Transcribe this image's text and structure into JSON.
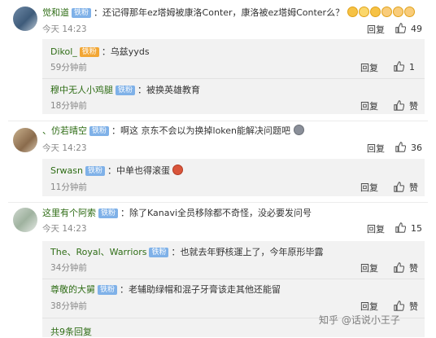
{
  "comments": [
    {
      "user": "觉和道",
      "badge": "铁粉",
      "text": "：还记得那年ez塔姆被康洛Conter，康洛被ez塔姆Conter么？",
      "time": "今天 14:23",
      "reply_label": "回复",
      "likes": "49",
      "emojis": [
        "laugh-emoji",
        "laugh-emoji",
        "laugh-emoji",
        "cat-emoji",
        "cat-emoji",
        "cat-emoji"
      ],
      "replies": [
        {
          "user": "Dikol_",
          "badge": "铁粉",
          "text": "：乌兹yyds",
          "time": "59分钟前",
          "reply_label": "回复",
          "likes": "1"
        },
        {
          "user": "穆中无人小鸡腿",
          "badge": "铁粉",
          "text": "：被换英雄教育",
          "time": "18分钟前",
          "reply_label": "回复",
          "likes": "赞"
        }
      ]
    },
    {
      "user": "、仿若晴空",
      "badge": "铁粉",
      "text": "：啊这 京东不会以为换掉loken能解决问题吧",
      "time": "今天 14:23",
      "reply_label": "回复",
      "likes": "36",
      "replies": [
        {
          "user": "Srwasn",
          "badge": "铁粉",
          "text": "：中单也得滚蛋",
          "time": "11分钟前",
          "reply_label": "回复",
          "likes": "赞"
        }
      ]
    },
    {
      "user": "这里有个阿索",
      "badge": "铁粉",
      "text": "：除了Kanavi全员移除都不奇怪，没必要发问号",
      "time": "今天 14:23",
      "reply_label": "回复",
      "likes": "15",
      "replies": [
        {
          "user": "The、Royal、Warriors",
          "badge": "铁粉",
          "text": "：也就去年野核運上了，今年原形毕露",
          "time": "34分钟前",
          "reply_label": "回复",
          "likes": "赞"
        },
        {
          "user": "尊敬的大舅",
          "badge": "铁粉",
          "text": "：老辅助绿帽和混子牙膏该走其他还能留",
          "time": "38分钟前",
          "reply_label": "回复",
          "likes": "赞"
        }
      ]
    }
  ],
  "more_replies": "共9条回复",
  "watermark": "知乎 @话说小王子",
  "colors": {
    "username": "#2f6d16",
    "badge": "#7fb1e8",
    "reply_bg": "#f2f2f2"
  }
}
